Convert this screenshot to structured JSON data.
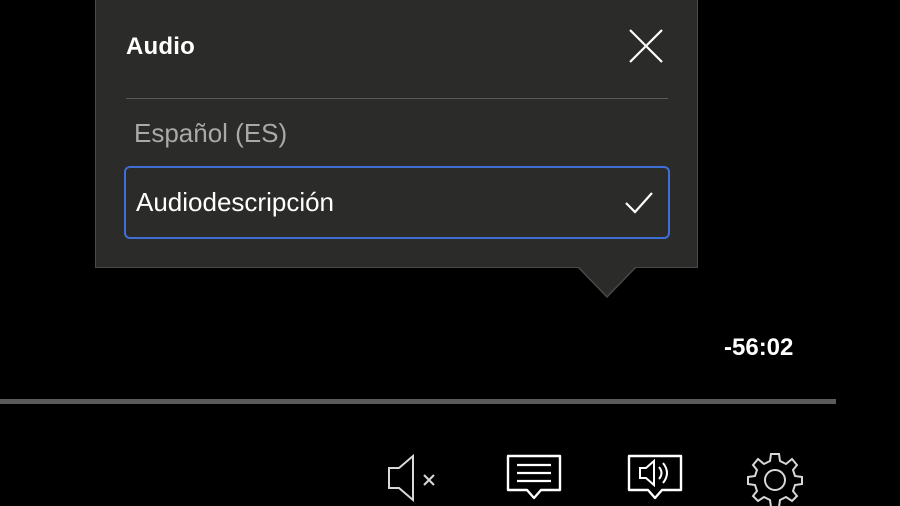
{
  "popup": {
    "title": "Audio",
    "close_icon": "close-icon",
    "options": [
      {
        "label": "Español (ES)",
        "selected": false
      },
      {
        "label": "Audiodescripción",
        "selected": true,
        "indicator_icon": "checkmark-icon"
      }
    ]
  },
  "player": {
    "time_remaining": "-56:02",
    "progress": 0,
    "controls": [
      {
        "name": "mute",
        "icon": "speaker-muted-icon"
      },
      {
        "name": "subtitles",
        "icon": "subtitles-icon"
      },
      {
        "name": "audio",
        "icon": "audio-track-icon"
      },
      {
        "name": "settings",
        "icon": "gear-icon"
      }
    ]
  },
  "colors": {
    "background": "#000000",
    "popup_background": "#2b2b29",
    "focus_border": "#3f6ed6",
    "inactive_text": "#a9a9a6",
    "progress_track": "#5b5b5b"
  }
}
